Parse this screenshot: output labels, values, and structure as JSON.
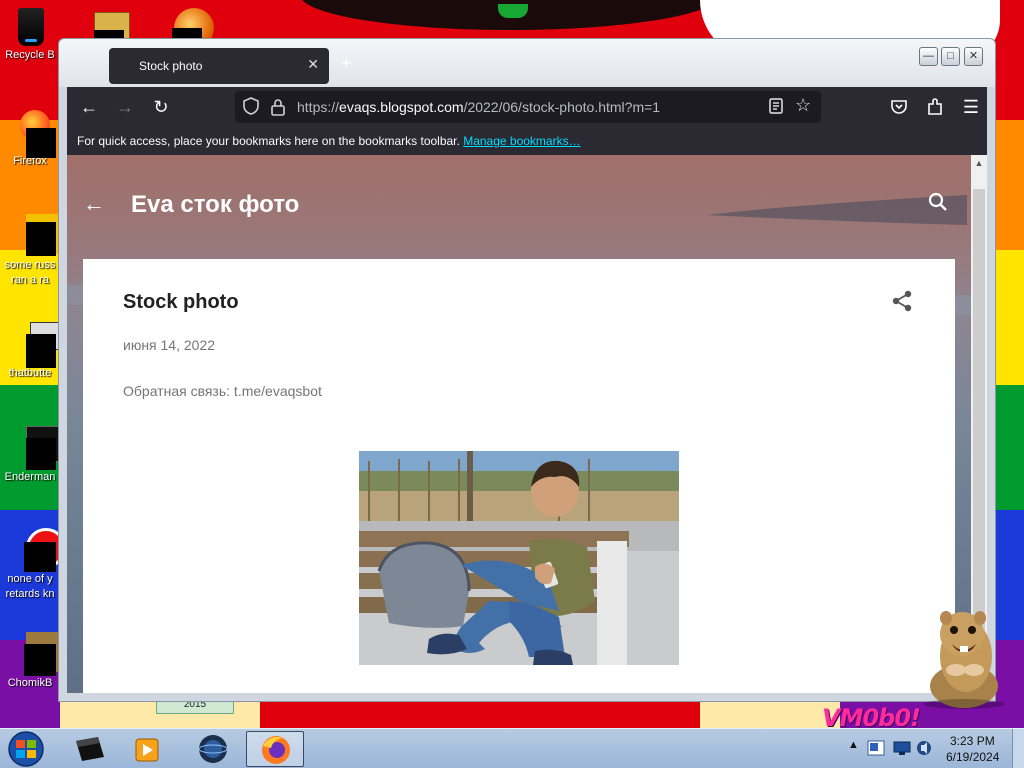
{
  "desktop": {
    "icons": [
      {
        "label": "Recycle Bin",
        "shown": "Recycle B"
      },
      {
        "label": "Firefox"
      },
      {
        "label_lines": [
          "some russ",
          "ran a ra"
        ]
      },
      {
        "label": "thatbutte"
      },
      {
        "label": "Enderman"
      },
      {
        "label_lines": [
          "none of y",
          "retards kn"
        ]
      },
      {
        "label": "ChomikB"
      }
    ],
    "watermark_text": "VM0b0!",
    "year_tag": "2015"
  },
  "browser": {
    "tab_title": "Stock photo",
    "tab_close": "✕",
    "new_tab": "+",
    "tab_list": "⌄",
    "url_base": "https://",
    "url_host": "evaqs.blogspot.com",
    "url_path": "/2022/06/stock-photo.html?m=1",
    "bookmarks_hint": "For quick access, place your bookmarks here on the bookmarks toolbar.",
    "bookmarks_link": "Manage bookmarks…"
  },
  "page": {
    "blog_title": "Eva сток фото",
    "post_title": "Stock photo",
    "post_date": "июня 14, 2022",
    "post_feedback": "Обратная связь: t.me/evaqsbot"
  },
  "taskbar": {
    "clock_time": "3:23 PM",
    "clock_date": "6/19/2024"
  },
  "colors": {
    "browser_chrome": "#2b2a33",
    "url_bar": "#1c1b22",
    "link": "#00ddff",
    "card": "#ffffff"
  }
}
